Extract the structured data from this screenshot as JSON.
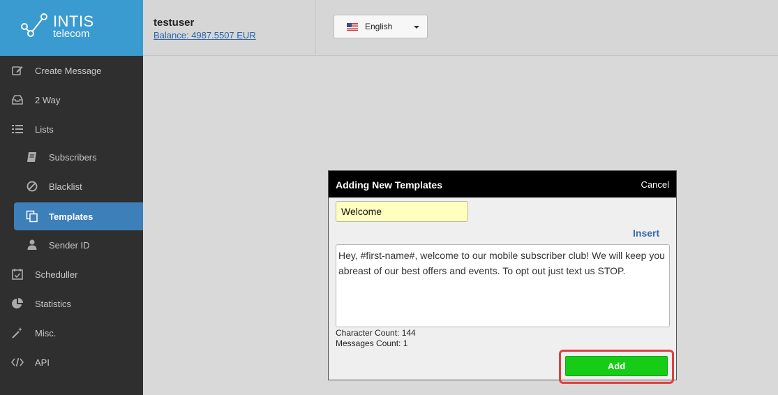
{
  "logo": {
    "name": "INTIS",
    "sub": "telecom"
  },
  "user": {
    "username": "testuser",
    "balance": "Balance: 4987.5507 EUR"
  },
  "language": {
    "selected": "English"
  },
  "nav": {
    "create_message": "Create Message",
    "two_way": "2 Way",
    "lists": "Lists",
    "subscribers": "Subscribers",
    "blacklist": "Blacklist",
    "templates": "Templates",
    "sender_id": "Sender ID",
    "scheduller": "Scheduller",
    "statistics": "Statistics",
    "misc": "Misc.",
    "api": "API"
  },
  "dialog": {
    "title": "Adding New Templates",
    "cancel": "Cancel",
    "name_value": "Welcome",
    "insert": "Insert",
    "message": "Hey, #first-name#, welcome to our mobile subscriber club! We will keep you abreast of our best offers and events. To opt out just text us STOP.",
    "char_count": "Character Count: 144",
    "msg_count": "Messages Count: 1",
    "add": "Add"
  },
  "colors": {
    "brand": "#3a9bd1",
    "active": "#3d7fb8",
    "add": "#17cc17",
    "highlight": "#e04040"
  }
}
